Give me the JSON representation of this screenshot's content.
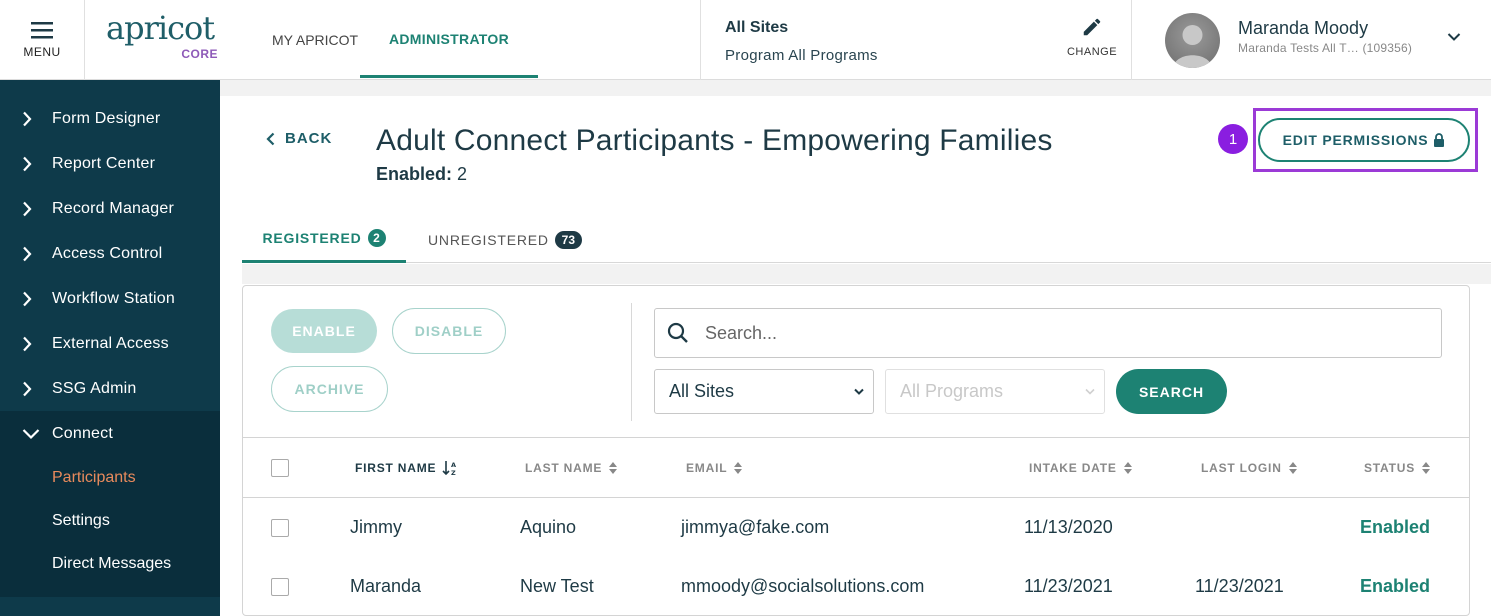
{
  "header": {
    "menu_label": "MENU",
    "logo_main": "apricot",
    "logo_sub": "CORE",
    "nav": [
      {
        "label": "MY APRICOT"
      },
      {
        "label": "ADMINISTRATOR"
      }
    ],
    "site": {
      "name": "All Sites",
      "program": "Program All Programs",
      "change_label": "CHANGE"
    },
    "user": {
      "name": "Maranda Moody",
      "subtitle": "Maranda Tests All T…  (109356)"
    }
  },
  "sidebar": {
    "items": [
      {
        "label": "Form Designer"
      },
      {
        "label": "Report Center"
      },
      {
        "label": "Record Manager"
      },
      {
        "label": "Access Control"
      },
      {
        "label": "Workflow Station"
      },
      {
        "label": "External Access"
      },
      {
        "label": "SSG Admin"
      }
    ],
    "expanded": {
      "label": "Connect",
      "children": [
        {
          "label": "Participants"
        },
        {
          "label": "Settings"
        },
        {
          "label": "Direct Messages"
        }
      ]
    },
    "active_color": "#e88a5c"
  },
  "page": {
    "back_label": "BACK",
    "title": "Adult Connect Participants - Empowering Families",
    "enabled_label": "Enabled:",
    "enabled_count": "2",
    "step_badge": "1",
    "edit_permissions_label": "EDIT PERMISSIONS",
    "tabs": [
      {
        "label": "REGISTERED",
        "count": "2"
      },
      {
        "label": "UNREGISTERED",
        "count": "73"
      }
    ]
  },
  "toolbar": {
    "enable_label": "ENABLE",
    "disable_label": "DISABLE",
    "archive_label": "ARCHIVE",
    "search_placeholder": "Search...",
    "sites_select": "All Sites",
    "programs_select": "All Programs",
    "search_button": "SEARCH"
  },
  "table": {
    "columns": [
      {
        "label": "FIRST NAME"
      },
      {
        "label": "LAST NAME"
      },
      {
        "label": "EMAIL"
      },
      {
        "label": "INTAKE DATE"
      },
      {
        "label": "LAST LOGIN"
      },
      {
        "label": "STATUS"
      }
    ],
    "rows": [
      {
        "first": "Jimmy",
        "last": "Aquino",
        "email": "jimmya@fake.com",
        "intake": "11/13/2020",
        "login": "",
        "status": "Enabled"
      },
      {
        "first": "Maranda",
        "last": "New Test",
        "email": "mmoody@socialsolutions.com",
        "intake": "11/23/2021",
        "login": "11/23/2021",
        "status": "Enabled"
      }
    ]
  },
  "colors": {
    "primary": "#1d8273",
    "sidebar": "#0e3a4a",
    "highlight": "#9b3ad6",
    "badge": "#8a1ee0"
  }
}
